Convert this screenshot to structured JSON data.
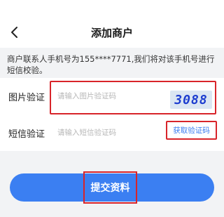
{
  "header": {
    "title": "添加商户",
    "back_icon": "chevron-left-icon"
  },
  "notice": {
    "text": "商户联系人手机号为155****7771,我们将对该手机号进行短信校验。"
  },
  "form": {
    "image_captcha": {
      "label": "图片验证",
      "placeholder": "请输入图片验证码",
      "value": "",
      "captcha_text": "3088"
    },
    "sms_code": {
      "label": "短信验证",
      "placeholder": "请输入短信验证码",
      "value": "",
      "get_code_label": "获取验证码"
    }
  },
  "submit": {
    "label": "提交资料"
  },
  "colors": {
    "primary": "#3b7ff2",
    "highlight": "#d8242a",
    "background": "#f2f3f5"
  }
}
